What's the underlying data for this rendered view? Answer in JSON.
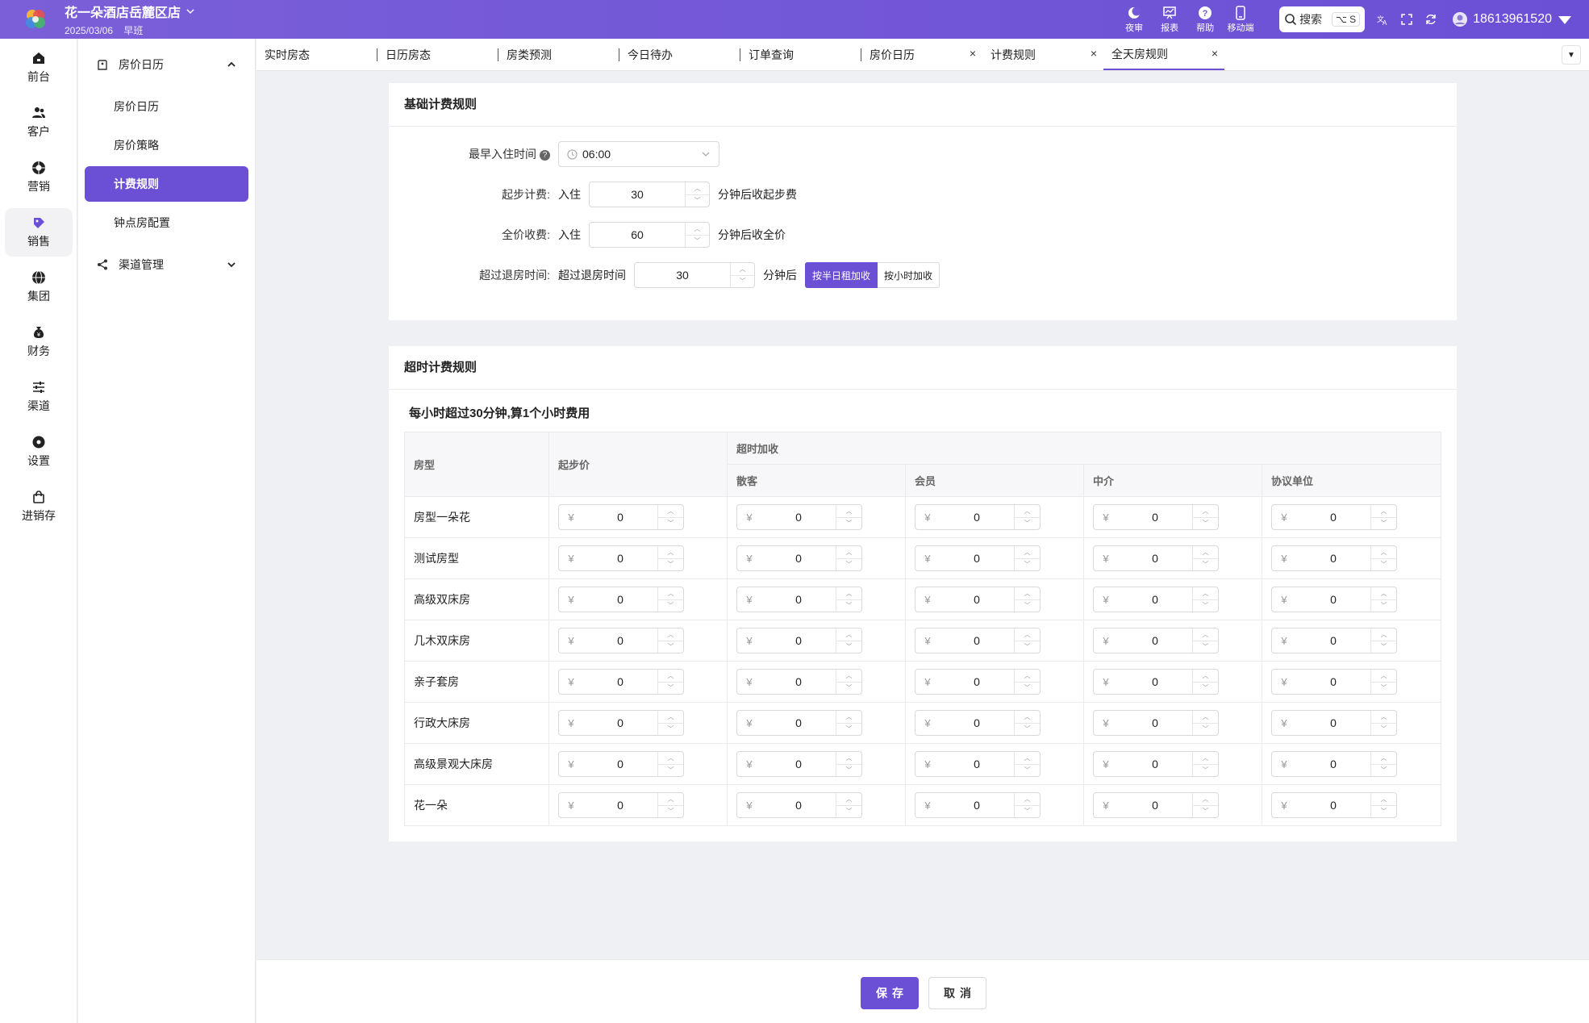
{
  "header": {
    "hotel_name": "花一朵酒店岳麓区店",
    "date": "2025/03/06",
    "shift": "早班",
    "tools": [
      {
        "label": "夜审",
        "icon": "moon-icon"
      },
      {
        "label": "报表",
        "icon": "report-icon"
      },
      {
        "label": "帮助",
        "icon": "help-icon"
      },
      {
        "label": "移动端",
        "icon": "mobile-icon"
      }
    ],
    "search_label": "搜索",
    "search_shortcut": "⌥ S",
    "user_phone": "18613961520"
  },
  "nav": {
    "items": [
      {
        "label": "前台",
        "icon": "house-icon",
        "active": false
      },
      {
        "label": "客户",
        "icon": "users-icon",
        "active": false
      },
      {
        "label": "营销",
        "icon": "aperture-icon",
        "active": false
      },
      {
        "label": "销售",
        "icon": "tag-icon",
        "active": true
      },
      {
        "label": "集团",
        "icon": "globe-icon",
        "active": false
      },
      {
        "label": "财务",
        "icon": "money-bag-icon",
        "active": false
      },
      {
        "label": "渠道",
        "icon": "sliders-icon",
        "active": false
      },
      {
        "label": "设置",
        "icon": "gear-icon",
        "active": false
      },
      {
        "label": "进销存",
        "icon": "shopping-bag-icon",
        "active": false
      }
    ]
  },
  "subnav": {
    "group1": "房价日历",
    "items": [
      "房价日历",
      "房价策略",
      "计费规则",
      "钟点房配置"
    ],
    "active_index": 2,
    "group2": "渠道管理"
  },
  "tabs": [
    {
      "label": "实时房态",
      "closable": false
    },
    {
      "label": "日历房态",
      "closable": false
    },
    {
      "label": "房类预测",
      "closable": false
    },
    {
      "label": "今日待办",
      "closable": false
    },
    {
      "label": "订单查询",
      "closable": false
    },
    {
      "label": "房价日历",
      "closable": true
    },
    {
      "label": "计费规则",
      "closable": true
    },
    {
      "label": "全天房规则",
      "closable": true,
      "active": true
    }
  ],
  "basic": {
    "title": "基础计费规则",
    "earliest_label": "最早入住时间",
    "earliest_value": "06:00",
    "start_label": "起步计费:",
    "start_pre": "入住",
    "start_value": "30",
    "start_post": "分钟后收起步费",
    "full_label": "全价收费:",
    "full_pre": "入住",
    "full_value": "60",
    "full_post": "分钟后收全价",
    "over_label": "超过退房时间:",
    "over_pre": "超过退房时间",
    "over_value": "30",
    "over_post": "分钟后",
    "seg_on": "按半日租加收",
    "seg_off": "按小时加收"
  },
  "overtime": {
    "title": "超时计费规则",
    "note": "每小时超过30分钟,算1个小时费用",
    "col_room": "房型",
    "col_start": "起步价",
    "col_group": "超时加收",
    "cols": [
      "散客",
      "会员",
      "中介",
      "协议单位"
    ],
    "currency": "¥",
    "rows": [
      {
        "name": "房型一朵花",
        "start": "0",
        "vals": [
          "0",
          "0",
          "0",
          "0"
        ]
      },
      {
        "name": "测试房型",
        "start": "0",
        "vals": [
          "0",
          "0",
          "0",
          "0"
        ]
      },
      {
        "name": "高级双床房",
        "start": "0",
        "vals": [
          "0",
          "0",
          "0",
          "0"
        ]
      },
      {
        "name": "几木双床房",
        "start": "0",
        "vals": [
          "0",
          "0",
          "0",
          "0"
        ]
      },
      {
        "name": "亲子套房",
        "start": "0",
        "vals": [
          "0",
          "0",
          "0",
          "0"
        ]
      },
      {
        "name": "行政大床房",
        "start": "0",
        "vals": [
          "0",
          "0",
          "0",
          "0"
        ]
      },
      {
        "name": "高级景观大床房",
        "start": "0",
        "vals": [
          "0",
          "0",
          "0",
          "0"
        ]
      },
      {
        "name": "花一朵",
        "start": "0",
        "vals": [
          "0",
          "0",
          "0",
          "0"
        ]
      }
    ]
  },
  "footer": {
    "save": "保存",
    "cancel": "取消"
  }
}
